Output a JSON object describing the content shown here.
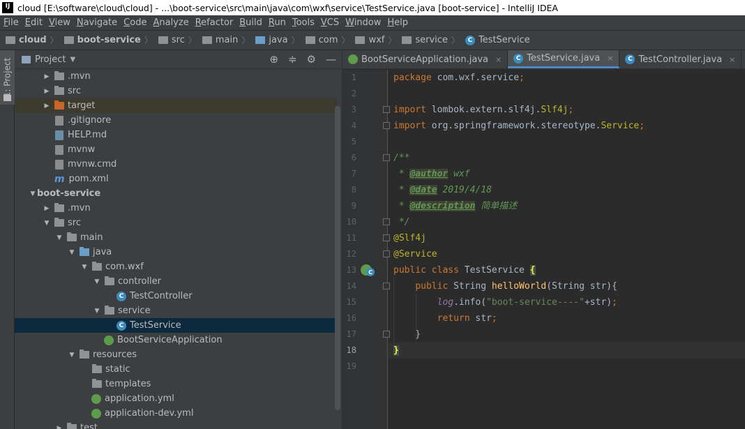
{
  "window": {
    "title": "cloud [E:\\software\\cloud\\cloud] - ...\\boot-service\\src\\main\\java\\com\\wxf\\service\\TestService.java [boot-service] - IntelliJ IDEA",
    "logo": "IJ"
  },
  "menu": [
    "File",
    "Edit",
    "View",
    "Navigate",
    "Code",
    "Analyze",
    "Refactor",
    "Build",
    "Run",
    "Tools",
    "VCS",
    "Window",
    "Help"
  ],
  "breadcrumb": [
    {
      "label": "cloud",
      "icon": "folder-icon",
      "bold": true
    },
    {
      "label": "boot-service",
      "icon": "folder-icon",
      "bold": true
    },
    {
      "label": "src",
      "icon": "folder-icon"
    },
    {
      "label": "main",
      "icon": "folder-icon"
    },
    {
      "label": "java",
      "icon": "source-folder-icon"
    },
    {
      "label": "com",
      "icon": "package-icon"
    },
    {
      "label": "wxf",
      "icon": "package-icon"
    },
    {
      "label": "service",
      "icon": "package-icon"
    },
    {
      "label": "TestService",
      "icon": "class-icon"
    }
  ],
  "tool_window": {
    "side_tab": "1: Project",
    "title": "Project"
  },
  "tree": [
    {
      "label": ".mvn",
      "kind": "folder",
      "depth": 2,
      "toggle": "collapsed"
    },
    {
      "label": "src",
      "kind": "folder",
      "depth": 2,
      "toggle": "collapsed"
    },
    {
      "label": "target",
      "kind": "folder-excluded",
      "depth": 2,
      "toggle": "collapsed"
    },
    {
      "label": ".gitignore",
      "kind": "file",
      "depth": 2
    },
    {
      "label": "HELP.md",
      "kind": "md",
      "depth": 2
    },
    {
      "label": "mvnw",
      "kind": "file",
      "depth": 2
    },
    {
      "label": "mvnw.cmd",
      "kind": "file",
      "depth": 2
    },
    {
      "label": "pom.xml",
      "kind": "maven",
      "depth": 2
    },
    {
      "label": "boot-service",
      "kind": "module",
      "depth": 1,
      "toggle": "expanded"
    },
    {
      "label": ".mvn",
      "kind": "folder",
      "depth": 2,
      "toggle": "collapsed"
    },
    {
      "label": "src",
      "kind": "folder",
      "depth": 2,
      "toggle": "expanded"
    },
    {
      "label": "main",
      "kind": "folder",
      "depth": 3,
      "toggle": "expanded"
    },
    {
      "label": "java",
      "kind": "source",
      "depth": 4,
      "toggle": "expanded"
    },
    {
      "label": "com.wxf",
      "kind": "package",
      "depth": 5,
      "toggle": "expanded"
    },
    {
      "label": "controller",
      "kind": "package",
      "depth": 6,
      "toggle": "expanded"
    },
    {
      "label": "TestController",
      "kind": "class",
      "depth": 7
    },
    {
      "label": "service",
      "kind": "package",
      "depth": 6,
      "toggle": "expanded"
    },
    {
      "label": "TestService",
      "kind": "class",
      "depth": 7,
      "selected": true
    },
    {
      "label": "BootServiceApplication",
      "kind": "spring",
      "depth": 6
    },
    {
      "label": "resources",
      "kind": "resources",
      "depth": 4,
      "toggle": "expanded"
    },
    {
      "label": "static",
      "kind": "folder",
      "depth": 5
    },
    {
      "label": "templates",
      "kind": "folder",
      "depth": 5
    },
    {
      "label": "application.yml",
      "kind": "spring",
      "depth": 5
    },
    {
      "label": "application-dev.yml",
      "kind": "spring",
      "depth": 5
    },
    {
      "label": "test",
      "kind": "folder",
      "depth": 3,
      "toggle": "collapsed"
    }
  ],
  "tabs": [
    {
      "label": "BootServiceApplication.java",
      "icon": "spring-class-icon",
      "active": false
    },
    {
      "label": "TestService.java",
      "icon": "class-icon",
      "active": true
    },
    {
      "label": "TestController.java",
      "icon": "class-icon",
      "active": false
    }
  ],
  "tab_close": "×",
  "editor": {
    "current_line": 18,
    "lines": [
      {
        "n": "1",
        "tokens": [
          [
            "kw",
            "package "
          ],
          [
            "",
            "com.wxf.service"
          ],
          [
            "kw",
            ";"
          ]
        ]
      },
      {
        "n": "2",
        "tokens": []
      },
      {
        "n": "3",
        "tokens": [
          [
            "kw",
            "import "
          ],
          [
            "",
            "lombok.extern.slf4j."
          ],
          [
            "ann",
            "Slf4j"
          ],
          [
            "kw",
            ";"
          ]
        ]
      },
      {
        "n": "4",
        "tokens": [
          [
            "kw",
            "import "
          ],
          [
            "",
            "org.springframework.stereotype."
          ],
          [
            "ann",
            "Service"
          ],
          [
            "kw",
            ";"
          ]
        ]
      },
      {
        "n": "5",
        "tokens": []
      },
      {
        "n": "6",
        "tokens": [
          [
            "cm",
            "/**"
          ]
        ]
      },
      {
        "n": "7",
        "tokens": [
          [
            "cm",
            " * "
          ],
          [
            "tag",
            "@author"
          ],
          [
            "cm",
            " wxf"
          ]
        ]
      },
      {
        "n": "8",
        "tokens": [
          [
            "cm",
            " * "
          ],
          [
            "tag",
            "@date"
          ],
          [
            "cm",
            " 2019/4/18"
          ]
        ]
      },
      {
        "n": "9",
        "tokens": [
          [
            "cm",
            " * "
          ],
          [
            "tag",
            "@description"
          ],
          [
            "cm",
            " 简单描述"
          ]
        ]
      },
      {
        "n": "10",
        "tokens": [
          [
            "cm",
            " */"
          ]
        ]
      },
      {
        "n": "11",
        "tokens": [
          [
            "ann",
            "@Slf4j"
          ]
        ]
      },
      {
        "n": "12",
        "tokens": [
          [
            "ann",
            "@Service"
          ]
        ]
      },
      {
        "n": "13",
        "tokens": [
          [
            "kw",
            "public class "
          ],
          [
            "",
            "TestService "
          ],
          [
            "brace",
            "{"
          ]
        ]
      },
      {
        "n": "14",
        "tokens": [
          [
            "",
            "    "
          ],
          [
            "kw",
            "public "
          ],
          [
            "",
            "String "
          ],
          [
            "fn",
            "helloWorld"
          ],
          [
            "",
            "(String str){"
          ]
        ]
      },
      {
        "n": "15",
        "tokens": [
          [
            "",
            "        "
          ],
          [
            "fld",
            "log"
          ],
          [
            "",
            ".info("
          ],
          [
            "str",
            "\"boot-service----\""
          ],
          [
            "",
            "+str)"
          ],
          [
            "kw",
            ";"
          ]
        ]
      },
      {
        "n": "16",
        "tokens": [
          [
            "",
            "        "
          ],
          [
            "kw",
            "return "
          ],
          [
            "",
            "str"
          ],
          [
            "kw",
            ";"
          ]
        ]
      },
      {
        "n": "17",
        "tokens": [
          [
            "",
            "    }"
          ]
        ]
      },
      {
        "n": "18",
        "tokens": [
          [
            "brace",
            "}"
          ]
        ]
      },
      {
        "n": "19",
        "tokens": []
      }
    ]
  }
}
